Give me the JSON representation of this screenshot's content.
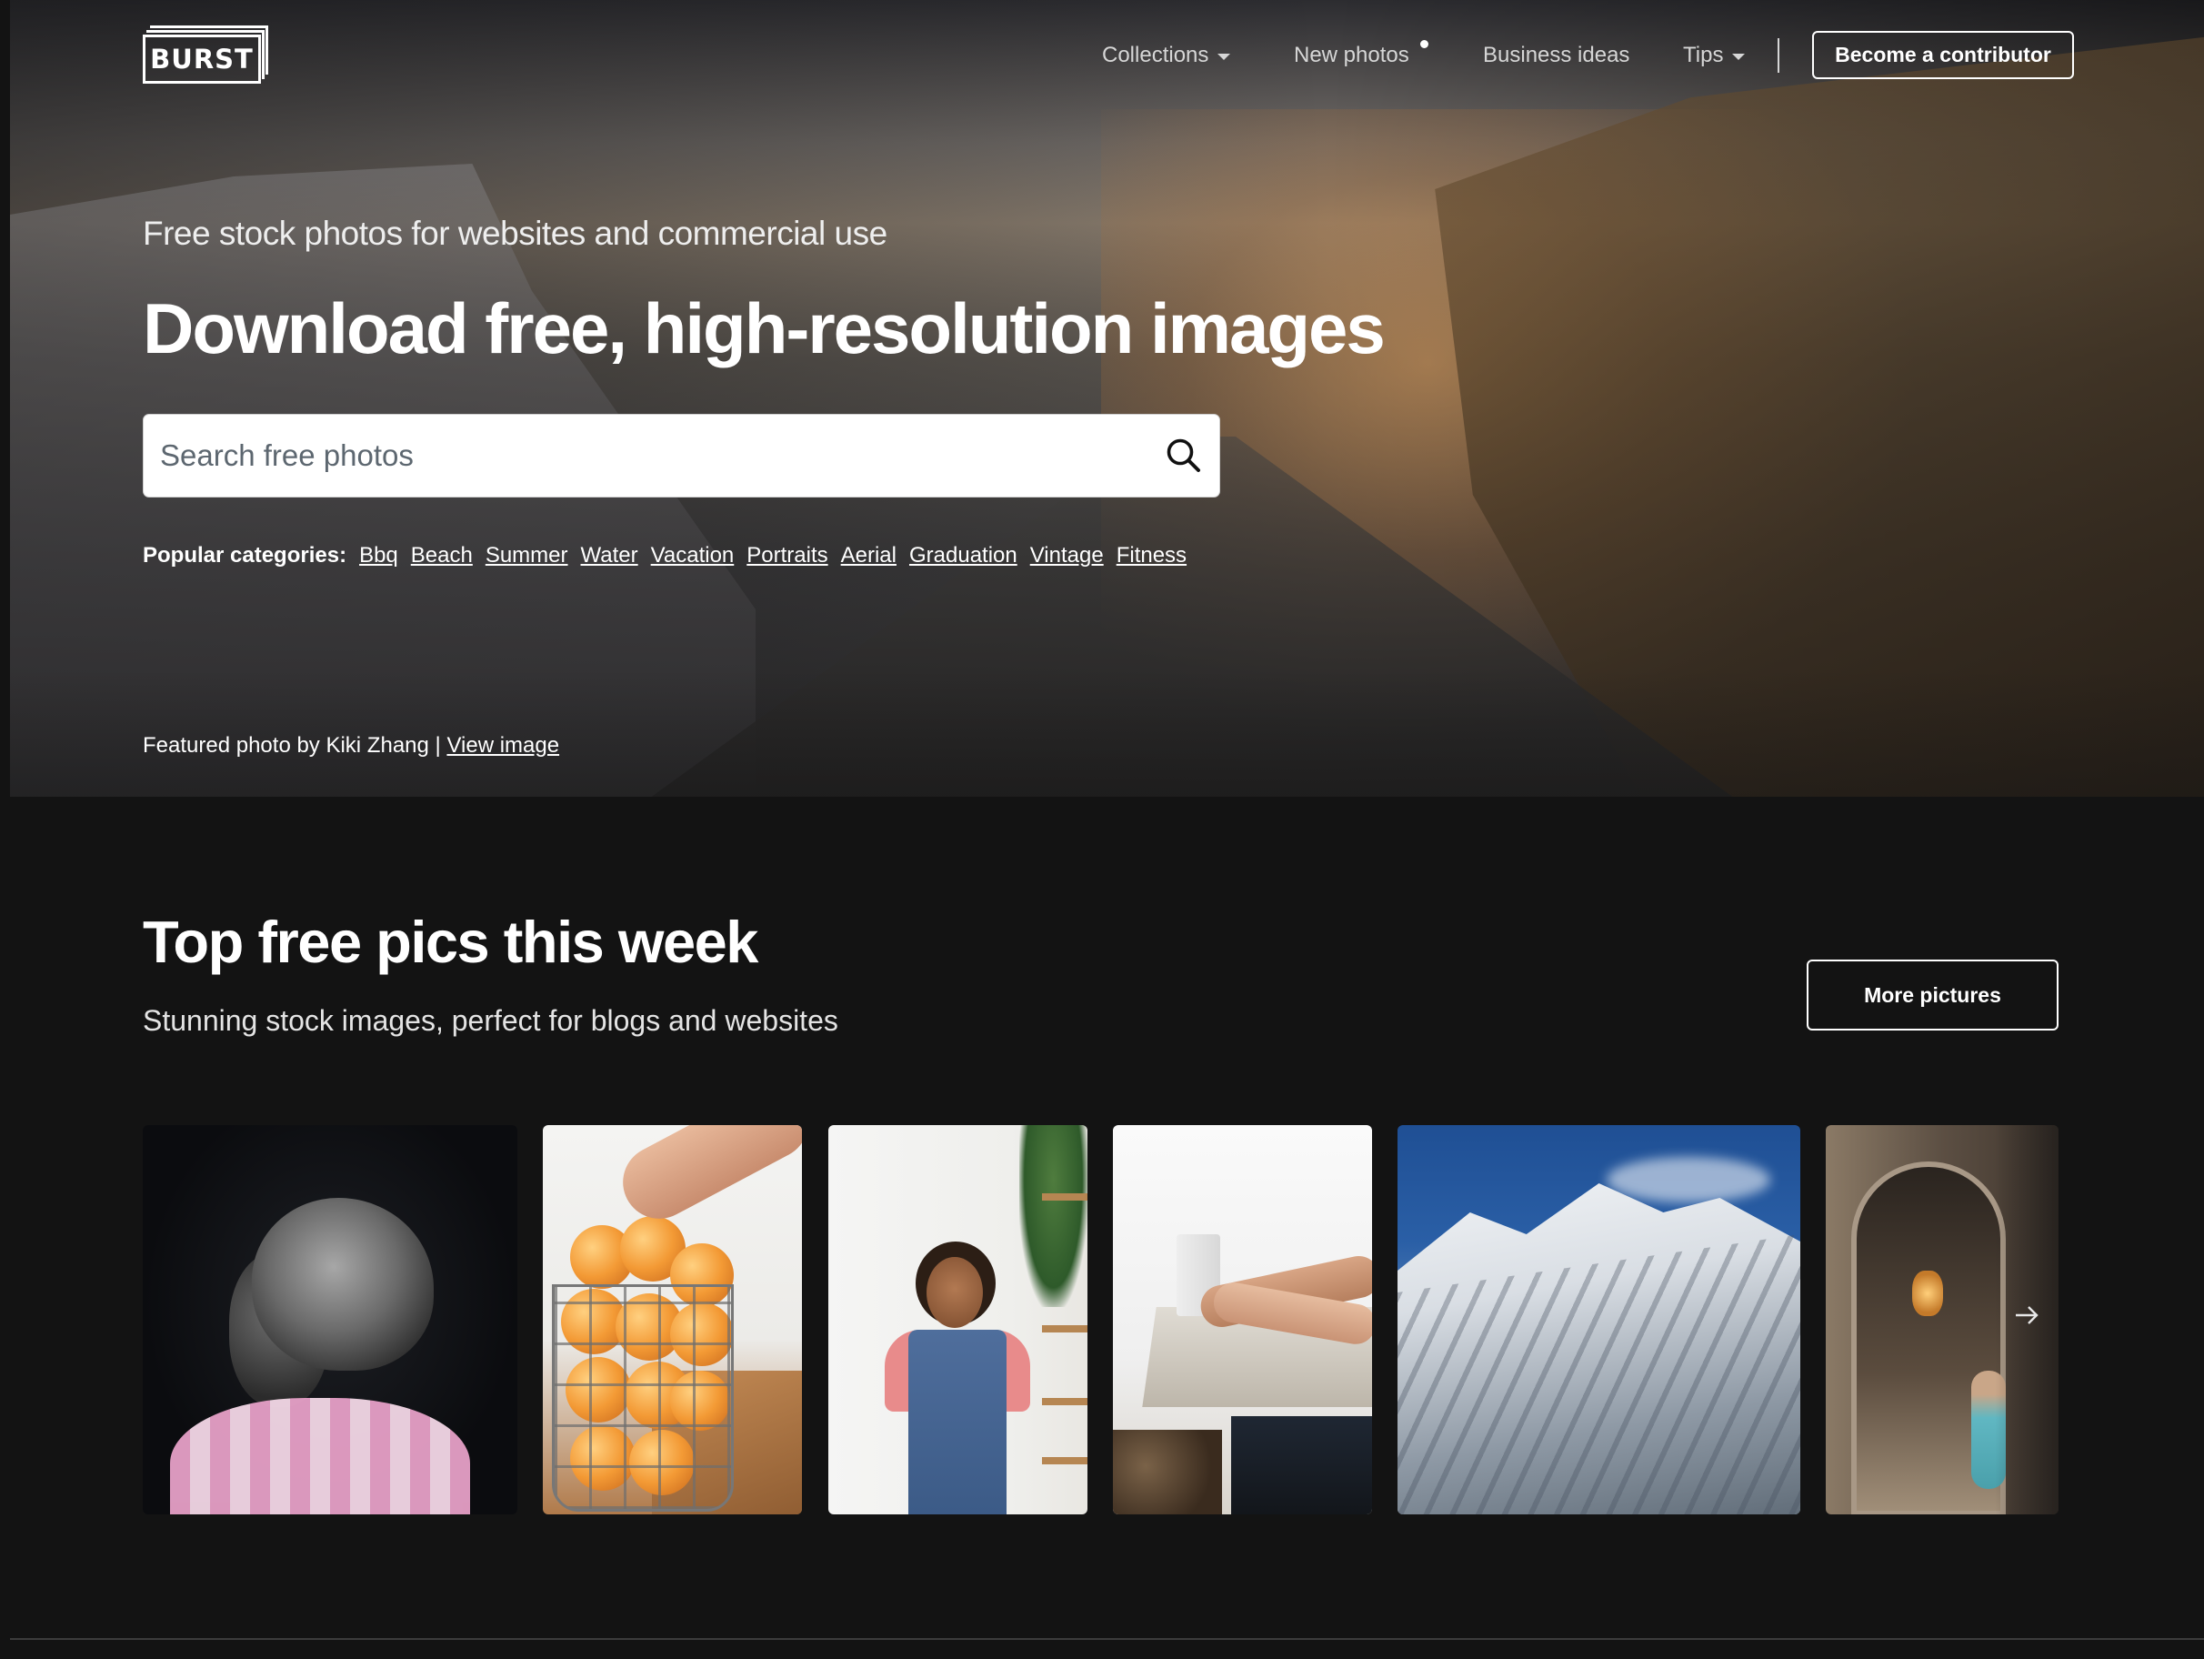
{
  "brand": {
    "logo_text": "BURST"
  },
  "nav": {
    "items": [
      {
        "label": "Collections",
        "has_caret": true
      },
      {
        "label": "New photos",
        "has_dot": true
      },
      {
        "label": "Business ideas"
      },
      {
        "label": "Tips",
        "has_caret": true
      }
    ],
    "cta_label": "Become a contributor"
  },
  "hero": {
    "tagline": "Free stock photos for websites and commercial use",
    "headline": "Download free, high-resolution images",
    "search": {
      "placeholder": "Search free photos",
      "value": ""
    },
    "categories_label": "Popular categories:",
    "categories": [
      "Bbq",
      "Beach",
      "Summer",
      "Water",
      "Vacation",
      "Portraits",
      "Aerial",
      "Graduation",
      "Vintage",
      "Fitness"
    ],
    "credit_prefix": "Featured photo by Kiki Zhang | ",
    "credit_link": "View image"
  },
  "section": {
    "title": "Top free pics this week",
    "subtitle": "Stunning stock images, perfect for blogs and websites",
    "more_label": "More pictures"
  },
  "icons": {
    "search": "search-icon",
    "next": "arrow-right-icon",
    "caret": "chevron-down-icon"
  },
  "colors": {
    "page_bg": "#131313",
    "text": "#ffffff",
    "nav_text": "#d6d6d6",
    "search_bg": "#ffffff",
    "placeholder": "#5d6770"
  }
}
